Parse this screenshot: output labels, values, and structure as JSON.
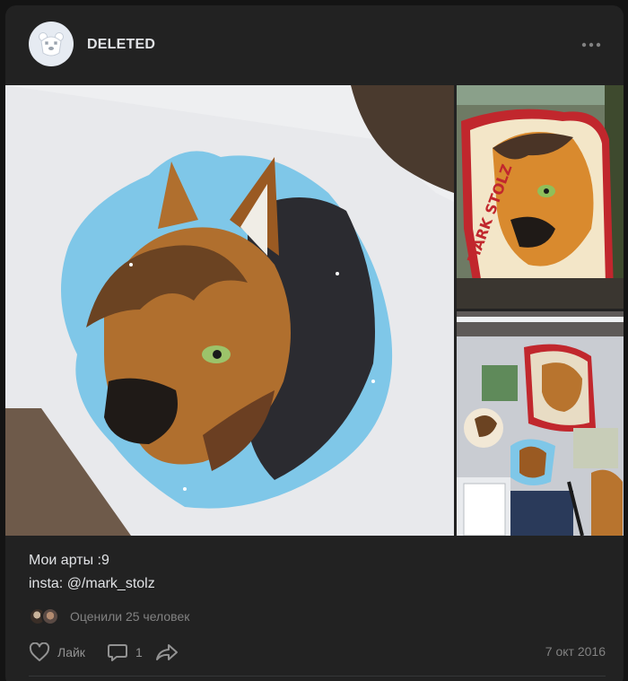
{
  "post": {
    "author": "DELETED",
    "text_lines": [
      "Мои арты :9",
      "insta: @/mark_stolz"
    ],
    "likers_text": "Оценили 25 человек",
    "date": "7 окт 2016",
    "sticker_caption": "MARK STOLZ"
  },
  "actions": {
    "like_label": "Лайк",
    "comment_count": "1"
  },
  "icons": {
    "avatar": "deleted-user-bear-icon",
    "more": "more-horizontal-icon",
    "like": "heart-outline-icon",
    "comment": "comment-icon",
    "share": "share-arrow-icon"
  },
  "colors": {
    "background": "#141414",
    "card": "#222222",
    "text_primary": "#e1e3e6",
    "text_secondary": "#828282"
  }
}
